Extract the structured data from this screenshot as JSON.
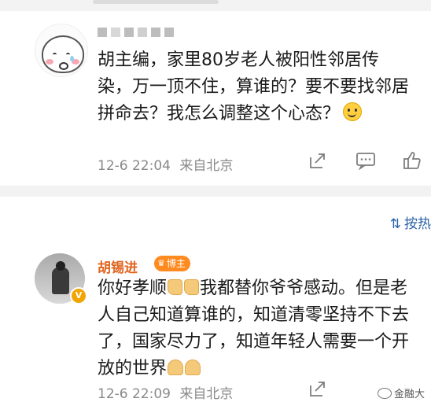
{
  "comment1": {
    "text": "胡主编，家里80岁老人被阳性邻居传染，万一顶不住，算谁的？要不要找邻居拼命去？我怎么调整这个心态？",
    "time": "12-6 22:04",
    "location": "来自北京",
    "avatar_icon": "crying-baby-avatar",
    "emoji_icon": "smile-emoji-icon"
  },
  "sort": {
    "label": "按热"
  },
  "comment2": {
    "author": "胡锡进",
    "badge": "博主",
    "text_part1": "你好孝顺",
    "text_part2": "我都替你爷爷感动。但是老人自己知道算谁的，知道清零坚持不下去了，国家尽力了，知道年轻人需要一个开放的世界",
    "time": "12-6 22:09",
    "location": "来自北京",
    "verified": "V"
  },
  "watermark": {
    "label": "金融大"
  },
  "colors": {
    "accent_name": "#e0651f",
    "badge_bg": "#ff8a1f",
    "link": "#2a63a8",
    "meta": "#8a8a8a"
  }
}
